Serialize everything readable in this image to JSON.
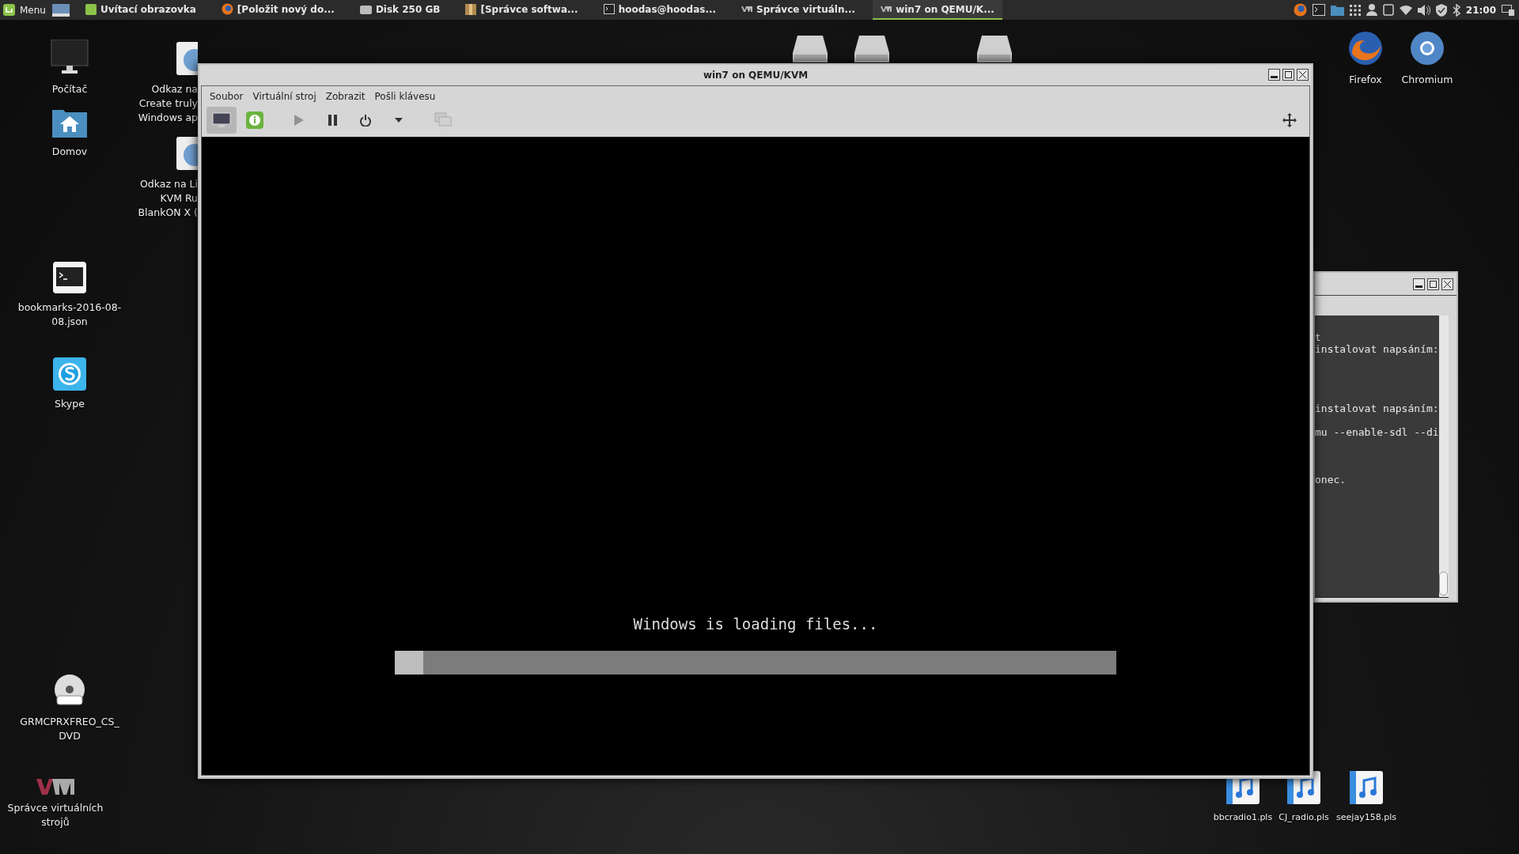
{
  "taskbar": {
    "menu": "Menu",
    "tasks": [
      {
        "label": "Uvítací obrazovka",
        "kind": "welcome",
        "selected": false
      },
      {
        "label": "[Položit nový do...",
        "kind": "firefox",
        "selected": false
      },
      {
        "label": "Disk 250 GB",
        "kind": "drive",
        "selected": false
      },
      {
        "label": "[Správce softwa...",
        "kind": "package",
        "selected": false
      },
      {
        "label": "hoodas@hoodas...",
        "kind": "terminal",
        "selected": false
      },
      {
        "label": "Správce virtuáln...",
        "kind": "vmm",
        "selected": false
      },
      {
        "label": "win7 on QEMU/K...",
        "kind": "vmm",
        "selected": true
      }
    ],
    "clock": "21:00"
  },
  "desktop_icons": [
    {
      "lines": [
        "Počítač"
      ],
      "kind": "monitor"
    },
    {
      "lines": [
        "Domov"
      ],
      "kind": "home"
    },
    {
      "lines": [
        "Odkaz na",
        "Create truly",
        "Windows ap"
      ],
      "kind": "globe"
    },
    {
      "lines": [
        "Odkaz na Li",
        "KVM Ru",
        "BlankON X ("
      ],
      "kind": "globe"
    },
    {
      "lines": [
        "bookmarks-2016-08-",
        "08.json"
      ],
      "kind": "terminal"
    },
    {
      "lines": [
        "Skype"
      ],
      "kind": "skype"
    },
    {
      "lines": [
        "GRMCPRXFREO_CS_",
        "DVD"
      ],
      "kind": "dvd"
    },
    {
      "lines": [
        "Správce virtuálních",
        "strojů"
      ],
      "kind": "vmm"
    },
    {
      "lines": [
        "Firefox"
      ],
      "kind": "firefox"
    },
    {
      "lines": [
        "Chromium"
      ],
      "kind": "chromium"
    },
    {
      "lines": [
        "bbcradio1.pls"
      ],
      "kind": "music"
    },
    {
      "lines": [
        "CJ_radio.pls"
      ],
      "kind": "music"
    },
    {
      "lines": [
        "seejay158.pls"
      ],
      "kind": "music"
    }
  ],
  "terminal_window": {
    "lines": [
      "t",
      "instalovat napsáním:",
      "instalovat napsáním:",
      "mu --enable-sdl --di",
      "onec."
    ]
  },
  "vm_window": {
    "title": "win7 on QEMU/KVM",
    "menu": [
      "Soubor",
      "Virtuální stroj",
      "Zobrazit",
      "Pošli klávesu"
    ],
    "toolbar": [
      {
        "kind": "console",
        "selected": true
      },
      {
        "kind": "details",
        "selected": false
      },
      {
        "kind": "run",
        "disabled": true
      },
      {
        "kind": "pause",
        "disabled": false
      },
      {
        "kind": "power",
        "disabled": false
      },
      {
        "kind": "dropdown",
        "disabled": false
      },
      {
        "kind": "snapshots",
        "disabled": true
      }
    ],
    "screen": {
      "message": "Windows is loading files...",
      "level": 0.04
    }
  }
}
